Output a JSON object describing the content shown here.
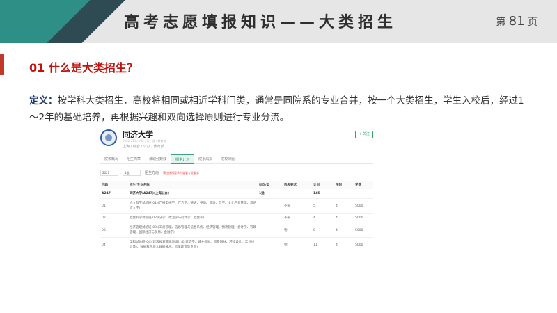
{
  "header": {
    "title": "高考志愿填报知识——大类招生",
    "page_prefix": "第",
    "page_number": "81",
    "page_suffix": "页"
  },
  "section": {
    "heading": "01 什么是大类招生？"
  },
  "definition": {
    "lead": "定义：",
    "body": "按学科大类招生，高校将相同或相近学科门类，通常是同院系的专业合并，按一个大类招生，学生入校后，经过1～2年的基础培养，再根据兴趣和双向选择原则进行专业分流。"
  },
  "screenshot": {
    "university": "同济大学",
    "sub_info": "2022-211 / 985 / 双一流 / 教育部",
    "tags": "上海 / 综合 / 公办 / 教育部",
    "fav_label": "+ 关注",
    "tabs": [
      {
        "label": "院校概况",
        "active": false
      },
      {
        "label": "招生简章",
        "active": false
      },
      {
        "label": "录取分数线",
        "active": false
      },
      {
        "label": "招生计划",
        "active": true
      },
      {
        "label": "院系风采",
        "active": false
      },
      {
        "label": "院校对比",
        "active": false
      }
    ],
    "filters": {
      "year": "2021",
      "batch": "1批",
      "direction_label": "招生方向",
      "hint": "请在选科要求中查看专业要求"
    },
    "table": {
      "headers": [
        "代码",
        "招生/专业名称",
        "批次/类",
        "选考要求",
        "计划",
        "学制",
        "学费"
      ],
      "rows": [
        {
          "code": "A247",
          "name": "同济大学(A247)(上海公办)",
          "batch": "1批",
          "req": "",
          "plan": "145",
          "years": "",
          "fee": "",
          "group": true
        },
        {
          "code": "01",
          "name": "人文科学试验班(01)(广播电视学、广告学、德语、英语、日语、哲学、文化产业管理、汉语言文学)",
          "batch": "",
          "req": "不限",
          "plan": "5",
          "years": "4",
          "fee": "5000",
          "group": false
        },
        {
          "code": "02",
          "name": "社会科学试验班(02)(法学、政治学与行政学、社会学)",
          "batch": "",
          "req": "不限",
          "plan": "4",
          "years": "4",
          "fee": "5000",
          "group": false
        },
        {
          "code": "03",
          "name": "经济管理试验班(03)(工商管理、信息管理与信息系统、经济管理、物流管理、会计学、行政管理、国际经济与贸易、金融学)",
          "batch": "",
          "req": "物",
          "plan": "8",
          "years": "4",
          "fee": "5000",
          "group": false
        },
        {
          "code": "04",
          "name": "工科试验班(04)(建筑规划景观与设计类(建筑学、城乡规划、风景园林、环境设计、工业设计等)、数据科学与大数据技术、智能建造等专业)",
          "batch": "",
          "req": "物",
          "plan": "11",
          "years": "4",
          "fee": "5000",
          "group": false
        }
      ]
    }
  }
}
